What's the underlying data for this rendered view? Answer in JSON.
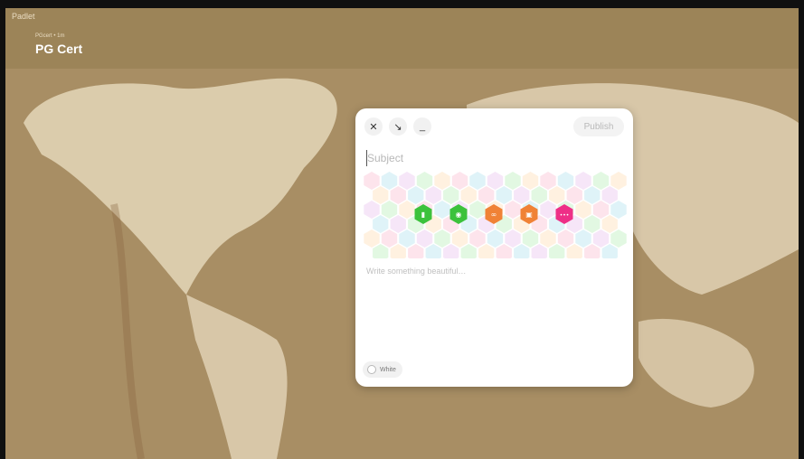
{
  "app": {
    "name": "Padlet"
  },
  "header": {
    "breadcrumb": "PGcert • 1m",
    "title": "PG Cert"
  },
  "composer": {
    "subject_placeholder": "Subject",
    "body_placeholder": "Write something beautiful…",
    "publish_label": "Publish",
    "color_label": "White",
    "tools": [
      {
        "icon": "close-icon",
        "glyph": "✕"
      },
      {
        "icon": "arrow-down-right-icon",
        "glyph": "↘"
      },
      {
        "icon": "minimize-icon",
        "glyph": "_"
      }
    ],
    "attachments": [
      {
        "icon": "document-icon",
        "color": "#3cc23c"
      },
      {
        "icon": "camera-icon",
        "color": "#3cc23c"
      },
      {
        "icon": "link-icon",
        "color": "#f08236"
      },
      {
        "icon": "image-icon",
        "color": "#f08236"
      },
      {
        "icon": "more-icon",
        "color": "#ee2f87"
      }
    ]
  },
  "colors": {
    "header_bg": "#9c8458",
    "map_bg": "#a88e64",
    "land": "#ece0c4",
    "hex_palette": [
      "#fde4ec",
      "#e2f8e2",
      "#dff3f8",
      "#fff1e0",
      "#f6e6f8"
    ]
  }
}
